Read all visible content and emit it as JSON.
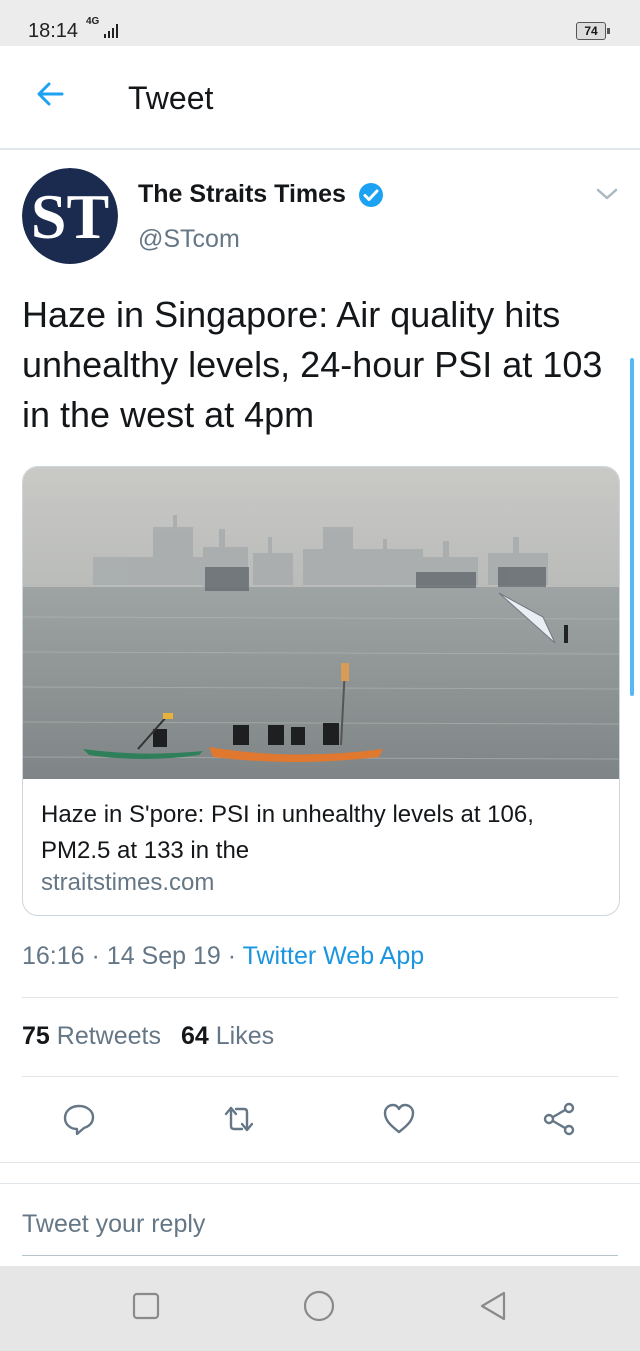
{
  "status_bar": {
    "time": "18:14",
    "network": "4G",
    "battery": "74"
  },
  "header": {
    "title": "Tweet"
  },
  "tweet": {
    "author_name": "The Straits Times",
    "handle": "@STcom",
    "avatar_text": "ST",
    "text": "Haze in Singapore: Air quality hits unhealthy levels, 24-hour PSI at 103 in the west at 4pm",
    "card": {
      "title": "Haze in S'pore: PSI in unhealthy levels at 106, PM2.5 at 133 in the",
      "domain": "straitstimes.com"
    },
    "time": "16:16",
    "date": "14 Sep 19",
    "separator": "·",
    "source": "Twitter Web App",
    "retweets_count": "75",
    "retweets_label": "Retweets",
    "likes_count": "64",
    "likes_label": "Likes"
  },
  "reply": {
    "placeholder": "Tweet your reply"
  },
  "colors": {
    "accent": "#1da1f2",
    "link": "#1b95e0",
    "secondary_text": "#657786",
    "brand_navy": "#1a2b4f"
  }
}
